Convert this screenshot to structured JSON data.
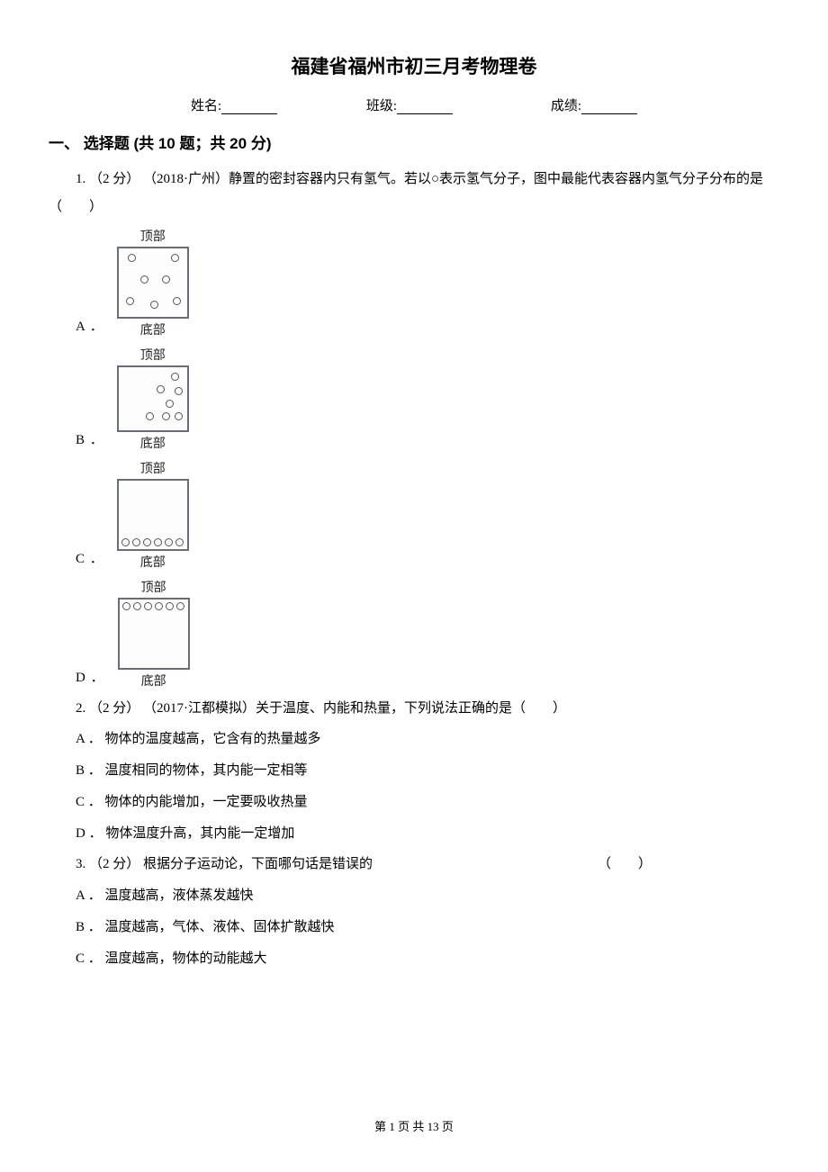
{
  "title": "福建省福州市初三月考物理卷",
  "info": {
    "name_label": "姓名:",
    "class_label": "班级:",
    "score_label": "成绩:"
  },
  "section1": {
    "header": "一、 选择题 (共 10 题；共 20 分)"
  },
  "q1": {
    "stem": "1. （2 分） （2018·广州）静置的密封容器内只有氢气。若以○表示氢气分子，图中最能代表容器内氢气分子分布的是（　　）",
    "top_label": "顶部",
    "bottom_label": "底部",
    "optA": "A ．",
    "optB": "B ．",
    "optC": "C ．",
    "optD": "D ．"
  },
  "q2": {
    "stem": "2. （2 分） （2017·江都模拟）关于温度、内能和热量，下列说法正确的是（　　）",
    "optA": "A ． 物体的温度越高，它含有的热量越多",
    "optB": "B ． 温度相同的物体，其内能一定相等",
    "optC": "C ． 物体的内能增加，一定要吸收热量",
    "optD": "D ． 物体温度升高，其内能一定增加"
  },
  "q3": {
    "stem_prefix": "3. （2 分）  根据分子运动论，下面哪句话是错误的",
    "stem_paren": "（　　）",
    "optA": "A ． 温度越高，液体蒸发越快",
    "optB": "B ． 温度越高，气体、液体、固体扩散越快",
    "optC": "C ． 温度越高，物体的动能越大"
  },
  "footer": {
    "text": "第 1 页 共 13 页"
  }
}
